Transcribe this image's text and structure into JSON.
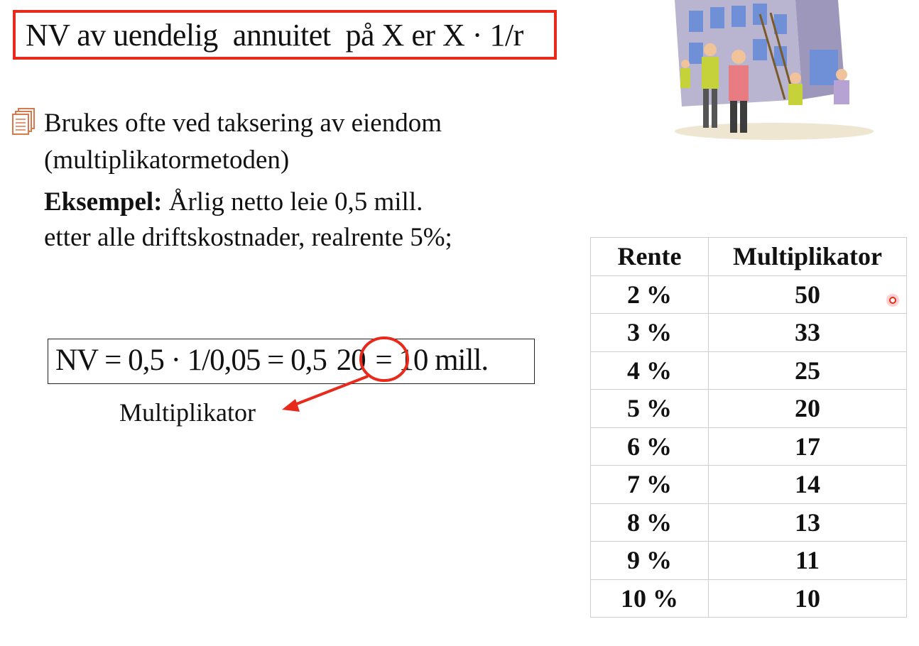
{
  "title": "NV av uendelig  annuitet  på X er X · 1/r",
  "bullet": {
    "line1": "Brukes ofte ved taksering av eiendom",
    "line2": "(multiplikatormetoden)"
  },
  "example": {
    "label": "Eksempel:",
    "line1_rest": " Årlig netto leie 0,5 mill.",
    "line2": "etter alle driftskostnader, realrente 5%;"
  },
  "formula": {
    "part1": "NV = 0,5 · 1/0,05 = 0,5 ",
    "circled": "20",
    "part2": " = 10 mill."
  },
  "multiplikator_label": "Multiplikator",
  "table": {
    "headers": [
      "Rente",
      "Multiplikator"
    ],
    "rows": [
      [
        "2 %",
        "50"
      ],
      [
        "3 %",
        "33"
      ],
      [
        "4 %",
        "25"
      ],
      [
        "5 %",
        "20"
      ],
      [
        "6 %",
        "17"
      ],
      [
        "7 %",
        "14"
      ],
      [
        "8 %",
        "13"
      ],
      [
        "9 %",
        "11"
      ],
      [
        "10 %",
        "10"
      ]
    ]
  },
  "colors": {
    "accent": "#e8291c"
  },
  "icons": {
    "bullet": "document-stack-icon",
    "clipart": "construction-workers-clipart"
  }
}
